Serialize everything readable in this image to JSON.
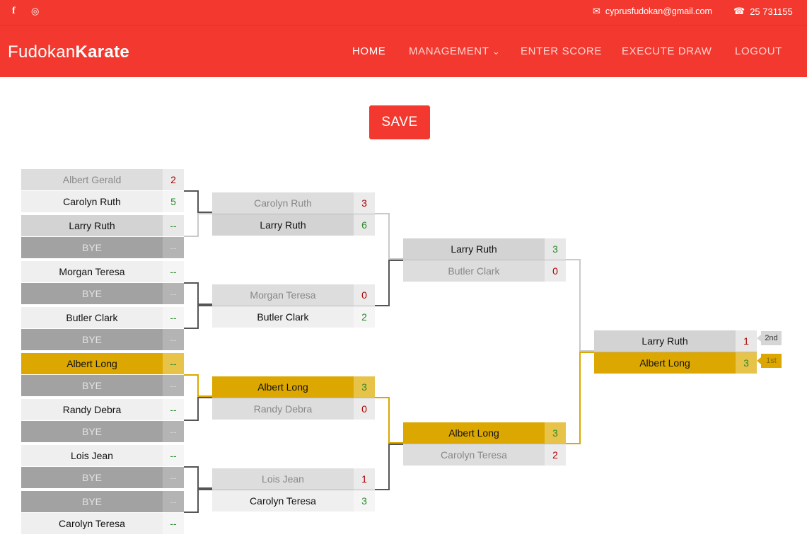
{
  "topbar": {
    "facebook_glyph": "f",
    "instagram_glyph": "◎",
    "email_glyph": "✉",
    "email": "cyprusfudokan@gmail.com",
    "phone_glyph": "☎",
    "phone": "25 731155"
  },
  "brand": {
    "part1": "Fudokan",
    "part2": "Karate"
  },
  "nav": {
    "home": "HOME",
    "management": "MANAGEMENT",
    "management_arrow": "⌄",
    "enter_score": "ENTER SCORE",
    "execute_draw": "EXECUTE DRAW",
    "logout": "LOGOUT"
  },
  "save_label": "SAVE",
  "bracket": {
    "round1": [
      {
        "a": {
          "name": "Albert Gerald",
          "score": "2"
        },
        "b": {
          "name": "Carolyn Ruth",
          "score": "5"
        }
      },
      {
        "a": {
          "name": "Larry Ruth",
          "score": "--"
        },
        "b": {
          "name": "BYE",
          "score": "--"
        }
      },
      {
        "a": {
          "name": "Morgan Teresa",
          "score": "--"
        },
        "b": {
          "name": "BYE",
          "score": "--"
        }
      },
      {
        "a": {
          "name": "Butler Clark",
          "score": "--"
        },
        "b": {
          "name": "BYE",
          "score": "--"
        }
      },
      {
        "a": {
          "name": "Albert Long",
          "score": "--"
        },
        "b": {
          "name": "BYE",
          "score": "--"
        }
      },
      {
        "a": {
          "name": "Randy Debra",
          "score": "--"
        },
        "b": {
          "name": "BYE",
          "score": "--"
        }
      },
      {
        "a": {
          "name": "Lois Jean",
          "score": "--"
        },
        "b": {
          "name": "BYE",
          "score": "--"
        }
      },
      {
        "a": {
          "name": "BYE",
          "score": "--"
        },
        "b": {
          "name": "Carolyn Teresa",
          "score": "--"
        }
      }
    ],
    "round2": [
      {
        "a": {
          "name": "Carolyn Ruth",
          "score": "3"
        },
        "b": {
          "name": "Larry Ruth",
          "score": "6"
        }
      },
      {
        "a": {
          "name": "Morgan Teresa",
          "score": "0"
        },
        "b": {
          "name": "Butler Clark",
          "score": "2"
        }
      },
      {
        "a": {
          "name": "Albert Long",
          "score": "3"
        },
        "b": {
          "name": "Randy Debra",
          "score": "0"
        }
      },
      {
        "a": {
          "name": "Lois Jean",
          "score": "1"
        },
        "b": {
          "name": "Carolyn Teresa",
          "score": "3"
        }
      }
    ],
    "round3": [
      {
        "a": {
          "name": "Larry Ruth",
          "score": "3"
        },
        "b": {
          "name": "Butler Clark",
          "score": "0"
        }
      },
      {
        "a": {
          "name": "Albert Long",
          "score": "3"
        },
        "b": {
          "name": "Carolyn Teresa",
          "score": "2"
        }
      }
    ],
    "final": {
      "a": {
        "name": "Larry Ruth",
        "score": "1"
      },
      "b": {
        "name": "Albert Long",
        "score": "3"
      }
    },
    "place_second": "2nd",
    "place_first": "1st"
  },
  "colors": {
    "brand_red": "#f3392f",
    "highlight_gold": "#dba700",
    "win_green": "#2a8a2a",
    "lose_red": "#aa0000"
  }
}
